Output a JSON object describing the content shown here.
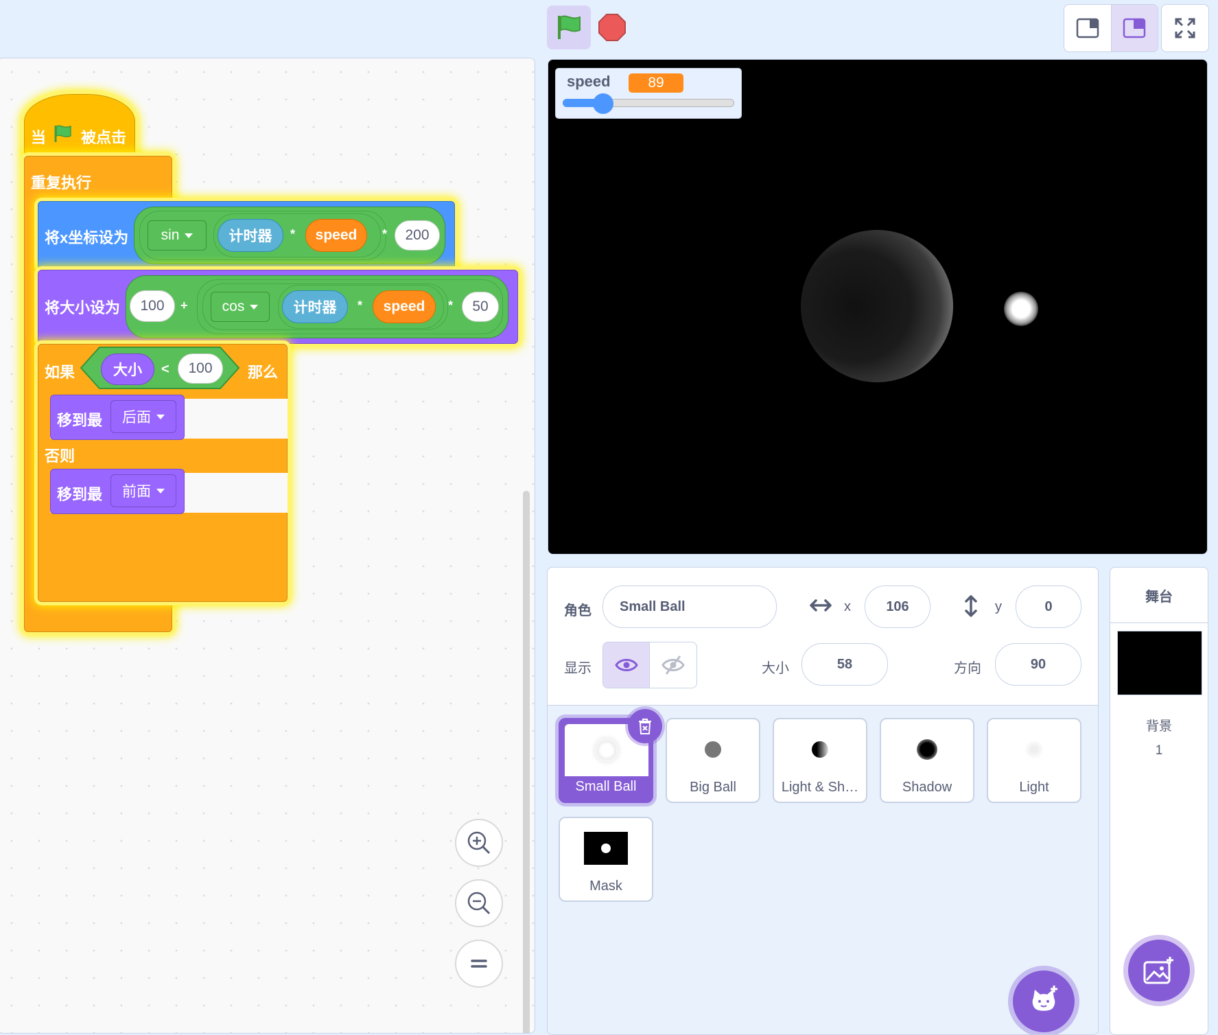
{
  "toolbar": {
    "green_flag_icon": "green-flag-icon",
    "stop_icon": "stop-sign-icon",
    "small_stage_icon": "small-stage-icon",
    "normal_stage_icon": "normal-stage-icon",
    "fullscreen_icon": "fullscreen-icon"
  },
  "script": {
    "hat": {
      "when": "当",
      "clicked": "被点击"
    },
    "forever": "重复执行",
    "set_x": {
      "label": "将x坐标设为",
      "func": "sin",
      "timer": "计时器",
      "op1": "*",
      "var": "speed",
      "op2": "*",
      "value": "200"
    },
    "set_size": {
      "label": "将大小设为",
      "value": "100",
      "plus": "+",
      "func": "cos",
      "timer": "计时器",
      "op1": "*",
      "var": "speed",
      "op2": "*",
      "factor": "50"
    },
    "if_else": {
      "if": "如果",
      "size": "大小",
      "lt": "<",
      "value": "100",
      "then": "那么",
      "else": "否则"
    },
    "go_back": {
      "label": "移到最",
      "option": "后面"
    },
    "go_front": {
      "label": "移到最",
      "option": "前面"
    }
  },
  "zoom": {
    "in_icon": "zoom-in-icon",
    "out_icon": "zoom-out-icon",
    "reset_icon": "zoom-reset-icon"
  },
  "monitor": {
    "name": "speed",
    "value": "89",
    "slider_fraction": 0.2
  },
  "sprite_info": {
    "sprite_label": "角色",
    "sprite_name": "Small Ball",
    "x_label": "x",
    "x": "106",
    "y_label": "y",
    "y": "0",
    "show_label": "显示",
    "size_label": "大小",
    "size": "58",
    "direction_label": "方向",
    "direction": "90"
  },
  "sprites": [
    {
      "name": "Small Ball",
      "selected": true
    },
    {
      "name": "Big Ball"
    },
    {
      "name": "Light & Sh…"
    },
    {
      "name": "Shadow"
    },
    {
      "name": "Light"
    },
    {
      "name": "Mask"
    }
  ],
  "stage_pane": {
    "title": "舞台",
    "backdrops_label": "背景",
    "backdrops_count": "1"
  },
  "colors": {
    "accent": "#855cd6",
    "events": "#ffbf00",
    "control": "#ffab19",
    "motion": "#4c97ff",
    "looks": "#9966ff",
    "operators": "#59c059",
    "sensing": "#5cb1d6",
    "variables": "#ff8c1a"
  }
}
